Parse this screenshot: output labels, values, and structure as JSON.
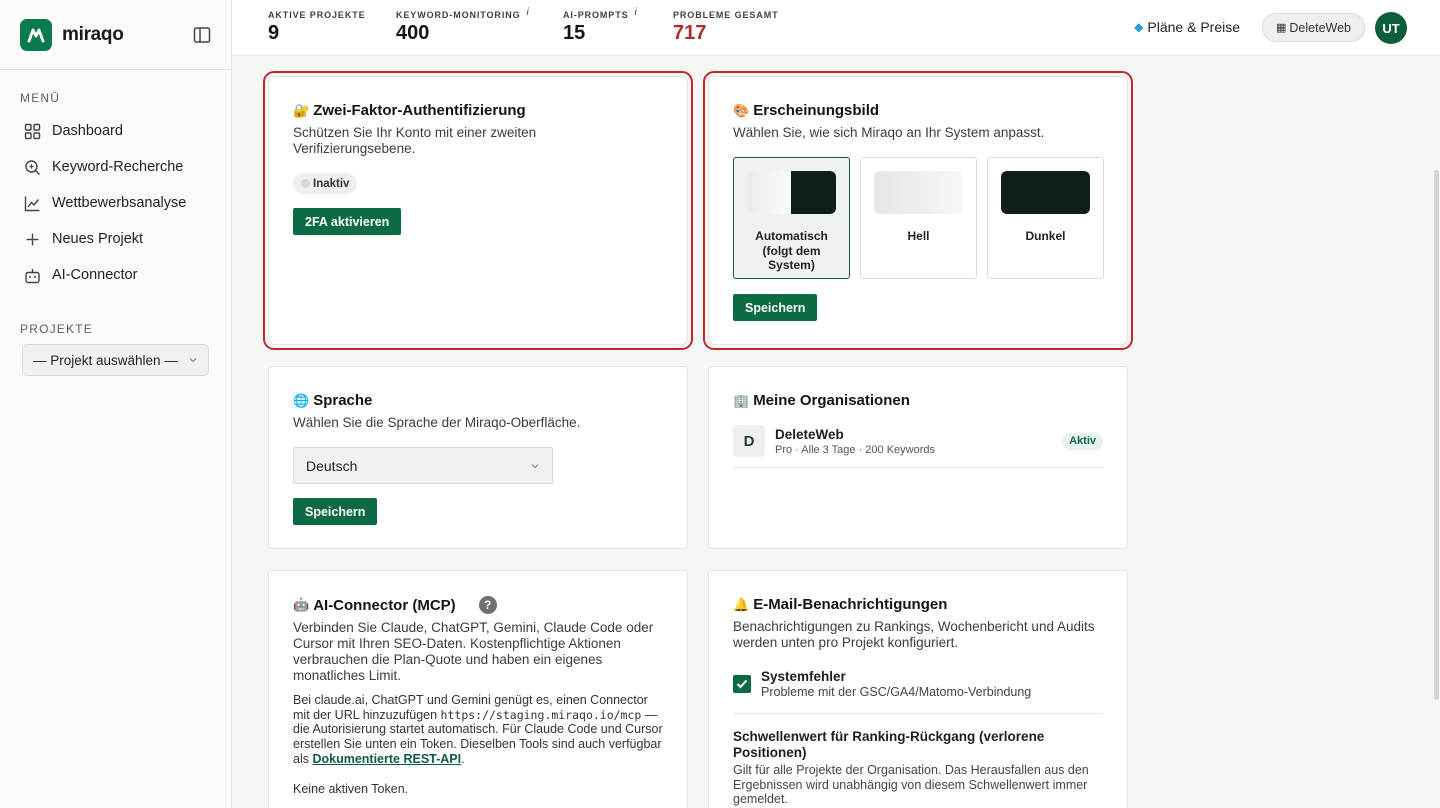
{
  "brand": {
    "name": "miraqo"
  },
  "sidebar": {
    "menu_label": "MENÜ",
    "items": [
      {
        "label": "Dashboard",
        "icon": "grid-icon"
      },
      {
        "label": "Keyword-Recherche",
        "icon": "search-icon"
      },
      {
        "label": "Wettbewerbsanalyse",
        "icon": "chart-line-icon"
      },
      {
        "label": "Neues Projekt",
        "icon": "plus-icon"
      },
      {
        "label": "AI-Connector",
        "icon": "robot-icon"
      }
    ],
    "projects_label": "PROJEKTE",
    "project_select": "— Projekt auswählen —"
  },
  "topbar": {
    "stats": [
      {
        "label": "AKTIVE PROJEKTE",
        "value": "9",
        "info": ""
      },
      {
        "label": "KEYWORD-MONITORING",
        "value": "400",
        "info": "i"
      },
      {
        "label": "AI-PROMPTS",
        "value": "15",
        "info": "i"
      },
      {
        "label": "PROBLEME GESAMT",
        "value": "717",
        "info": ""
      }
    ],
    "plans_label": "Pläne & Preise",
    "org_button": "DeleteWeb",
    "avatar_initials": "UT"
  },
  "twofa": {
    "title": "Zwei-Faktor-Authentifizierung",
    "desc": "Schützen Sie Ihr Konto mit einer zweiten Verifizierungsebene.",
    "status": "Inaktiv",
    "button": "2FA aktivieren"
  },
  "appearance": {
    "title": "Erscheinungsbild",
    "desc": "Wählen Sie, wie sich Miraqo an Ihr System anpasst.",
    "options": [
      {
        "label": "Automatisch (folgt dem System)",
        "selected": true
      },
      {
        "label": "Hell",
        "selected": false
      },
      {
        "label": "Dunkel",
        "selected": false
      }
    ],
    "button": "Speichern"
  },
  "language": {
    "title": "Sprache",
    "desc": "Wählen Sie die Sprache der Miraqo-Oberfläche.",
    "selected": "Deutsch",
    "button": "Speichern"
  },
  "orgs": {
    "title": "Meine Organisationen",
    "items": [
      {
        "initial": "D",
        "name": "DeleteWeb",
        "meta": "Pro · Alle 3 Tage · 200 Keywords",
        "status": "Aktiv"
      }
    ]
  },
  "connector": {
    "title": "AI-Connector (MCP)",
    "help": "?",
    "desc": "Verbinden Sie Claude, ChatGPT, Gemini, Claude Code oder Cursor mit Ihren SEO-Daten. Kostenpflichtige Aktionen verbrauchen die Plan-Quote und haben ein eigenes monatliches Limit.",
    "text_a": "Bei claude.ai, ChatGPT und Gemini genügt es, einen Connector mit der URL hinzuzufügen",
    "url": "https://staging.miraqo.io/mcp",
    "text_b": "— die Autorisierung startet automatisch. Für Claude Code und Cursor erstellen Sie unten ein Token. Dieselben Tools sind auch verfügbar als",
    "link": "Dokumentierte REST-API",
    "no_tokens": "Keine aktiven Token."
  },
  "email": {
    "title": "E-Mail-Benachrichtigungen",
    "desc": "Benachrichtigungen zu Rankings, Wochenbericht und Audits werden unten pro Projekt konfiguriert.",
    "system_error_title": "Systemfehler",
    "system_error_desc": "Probleme mit der GSC/GA4/Matomo-Verbindung",
    "threshold_title": "Schwellenwert für Ranking-Rückgang (verlorene Positionen)",
    "threshold_desc": "Gilt für alle Projekte der Organisation. Das Herausfallen aus den Ergebnissen wird unabhängig von diesem Schwellenwert immer gemeldet."
  },
  "colors": {
    "accent": "#0c6b45",
    "danger": "#b12b2b",
    "highlight": "#c0282d"
  }
}
